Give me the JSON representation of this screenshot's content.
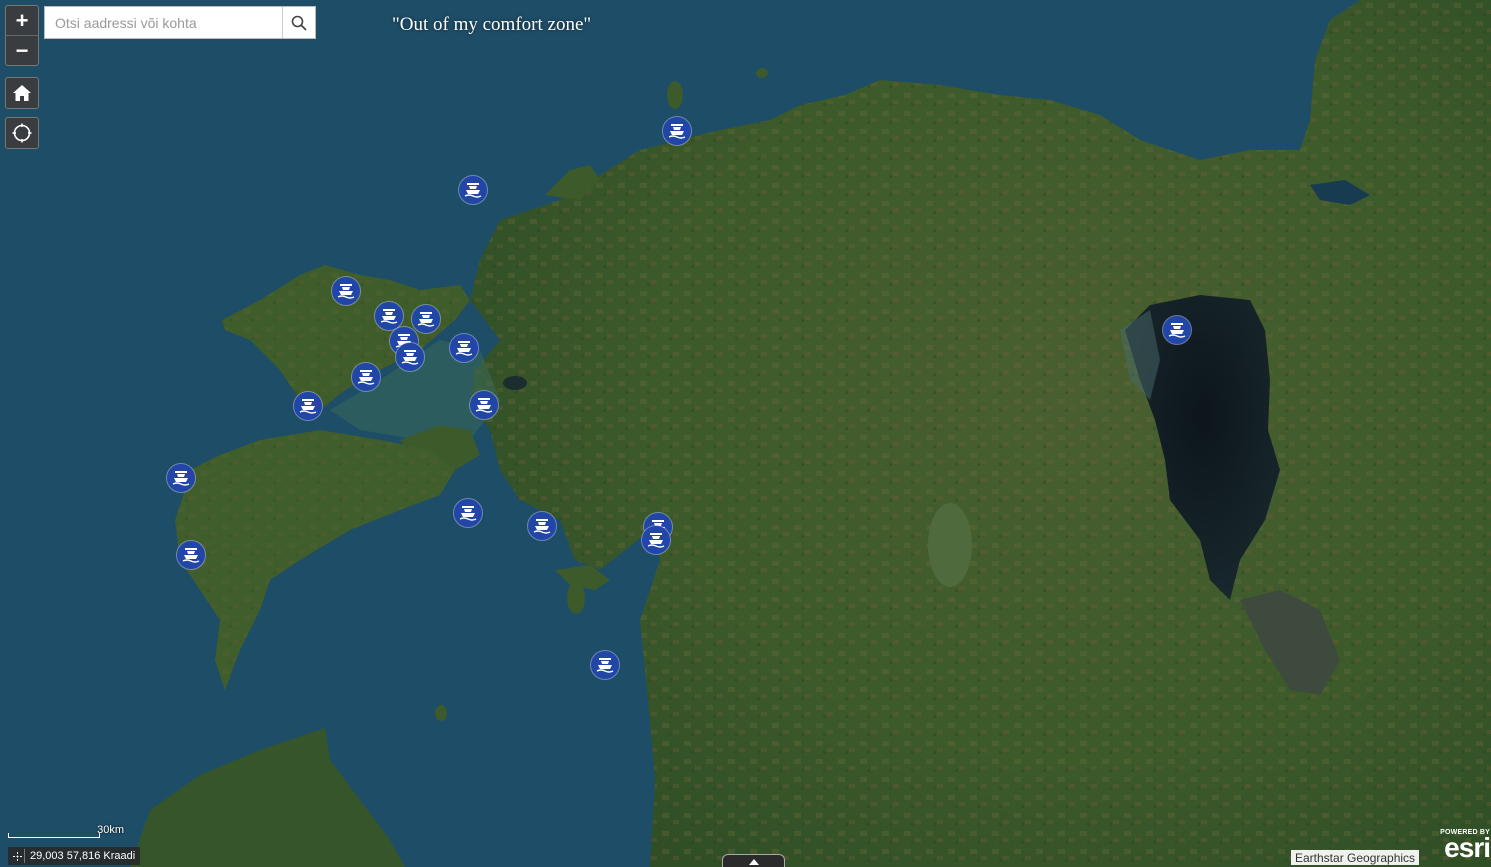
{
  "map": {
    "title": "\"Out of my comfort zone\"",
    "basemap": "satellite imagery",
    "marker_icon": "ship-icon",
    "marker_color": "#2146a6",
    "marker_count": 21
  },
  "search": {
    "placeholder": "Otsi aadressi või kohta",
    "value": ""
  },
  "controls": {
    "zoom_in": "+",
    "zoom_out": "−",
    "home_icon": "home-icon",
    "locate_icon": "locate-icon",
    "search_icon": "search-icon"
  },
  "scale": {
    "label": "30km"
  },
  "coordinates": {
    "text": "29,003 57,816 Kraadi"
  },
  "attribution": {
    "text": "Earthstar Geographics",
    "powered_by": "POWERED BY",
    "logo_text": "esri"
  },
  "colors": {
    "water": "#1d4a63",
    "land": "#3c5a2a",
    "lake": "#0e1c24"
  }
}
